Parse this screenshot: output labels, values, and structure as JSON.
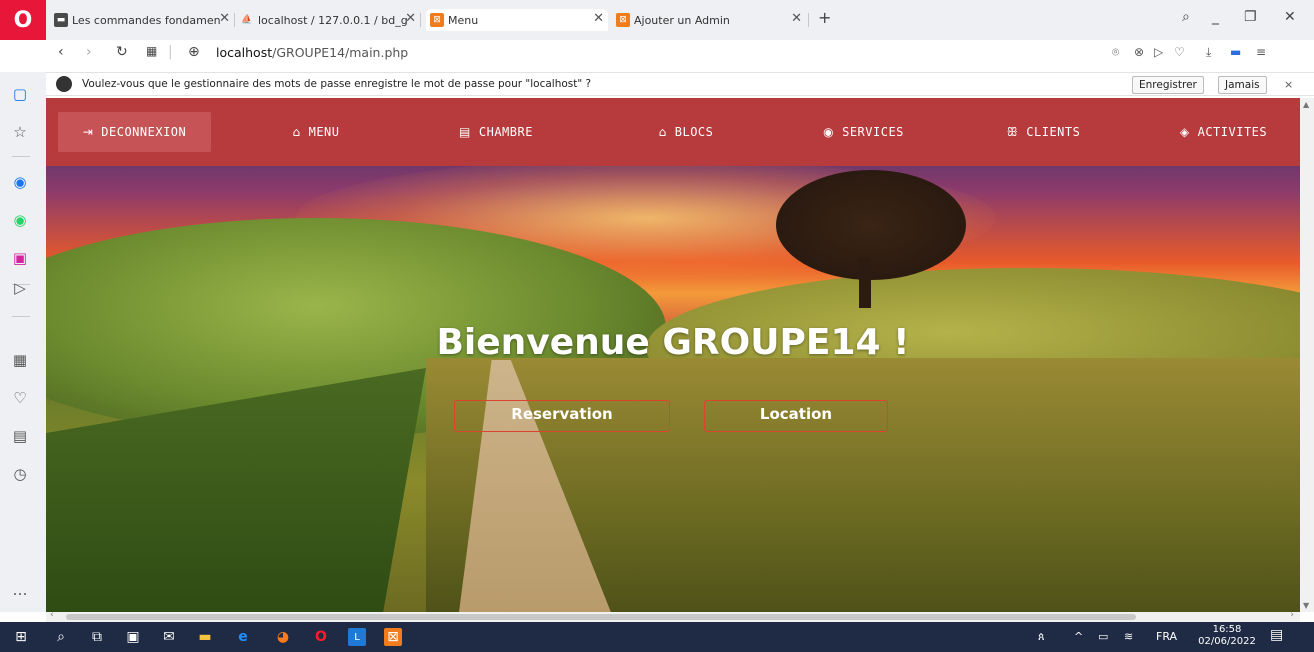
{
  "browser": {
    "tabs": [
      {
        "title": "Les commandes fondamen",
        "active": false
      },
      {
        "title": "localhost / 127.0.0.1 / bd_g",
        "active": false
      },
      {
        "title": "Menu",
        "active": true
      },
      {
        "title": "Ajouter un Admin",
        "active": false
      }
    ],
    "url_host": "localhost",
    "url_path": "/GROUPE14/main.php"
  },
  "password_prompt": {
    "message": "Voulez-vous que le gestionnaire des mots de passe enregistre le mot de passe pour \"localhost\" ?",
    "save_label": "Enregistrer",
    "never_label": "Jamais",
    "close": "×"
  },
  "nav": {
    "items": [
      {
        "label": "DECONNEXION",
        "icon": "logout-icon",
        "glyph": "⇥"
      },
      {
        "label": "MENU",
        "icon": "home-icon",
        "glyph": "⌂"
      },
      {
        "label": "CHAMBRE",
        "icon": "bed-icon",
        "glyph": "▤"
      },
      {
        "label": "BLOCS",
        "icon": "building-icon",
        "glyph": "⌂"
      },
      {
        "label": "SERVICES",
        "icon": "services-icon",
        "glyph": "◉"
      },
      {
        "label": "CLIENTS",
        "icon": "users-icon",
        "glyph": "ꕥ"
      },
      {
        "label": "ACTIVITES",
        "icon": "cube-icon",
        "glyph": "◈"
      }
    ]
  },
  "hero": {
    "title": "Bienvenue GROUPE14 !",
    "reservation_label": "Reservation",
    "location_label": "Location"
  },
  "taskbar": {
    "language": "FRA",
    "time": "16:58",
    "date": "02/06/2022"
  },
  "colors": {
    "nav_bg": "#b73a3c",
    "nav_active": "#c65456",
    "button_border": "#d9452f",
    "opera_red": "#e8173a"
  }
}
